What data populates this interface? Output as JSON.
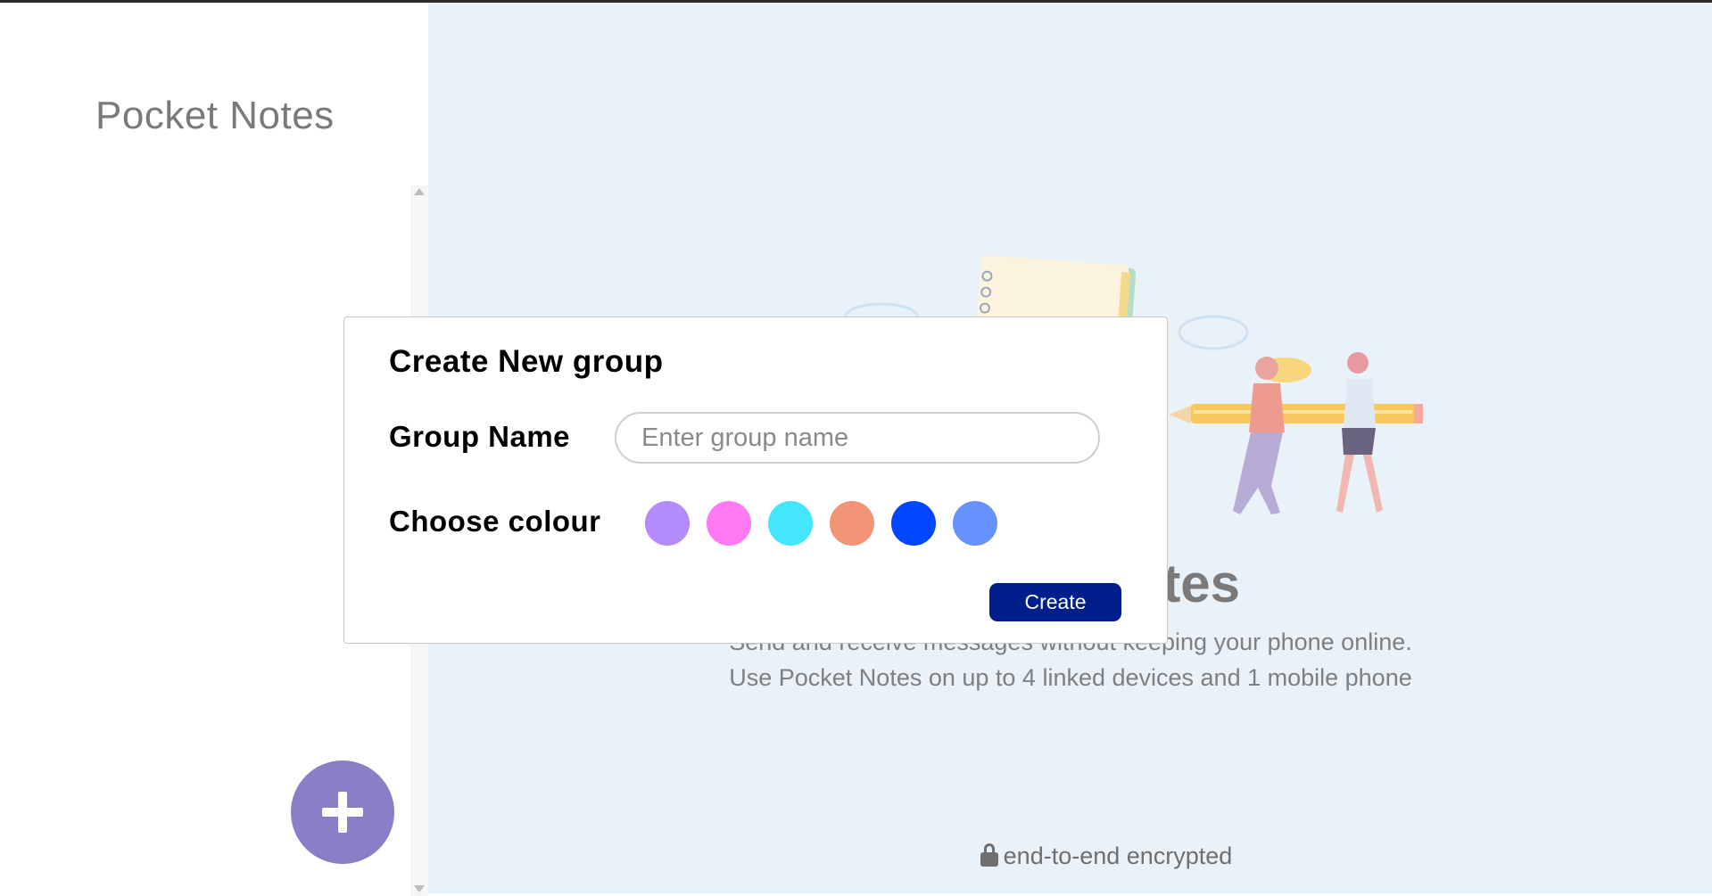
{
  "app": {
    "title": "Pocket Notes"
  },
  "hero": {
    "title": "Pocket Notes",
    "subtitle_line1": "Send and receive messages without keeping your phone online.",
    "subtitle_line2": "Use Pocket Notes on up to 4 linked devices and 1 mobile phone",
    "encrypted": "end-to-end encrypted"
  },
  "modal": {
    "title": "Create New group",
    "group_name_label": "Group Name",
    "group_name_placeholder": "Enter group name",
    "group_name_value": "",
    "colour_label": "Choose colour",
    "colours": [
      "#B38BFA",
      "#FF79F2",
      "#43E6FC",
      "#F19576",
      "#0047FF",
      "#6691FF"
    ],
    "create_label": "Create"
  },
  "icons": {
    "fab": "plus-icon",
    "lock": "lock-icon",
    "scroll_up": "scroll-up-arrow-icon",
    "scroll_down": "scroll-down-arrow-icon"
  },
  "colors": {
    "sidebar_bg": "#FFFFFF",
    "main_bg": "#E9F1F9",
    "fab": "#8C7EC6",
    "create_button": "#001F8B"
  }
}
